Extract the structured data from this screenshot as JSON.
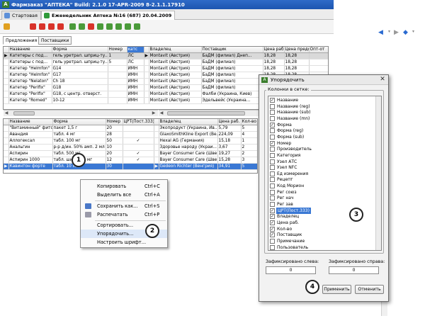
{
  "window": {
    "title": "Фармзаказ \"АПТЕКА\"   Build: 2.1.0 17-APR-2009 8-2.1.1.17910"
  },
  "tabs": [
    {
      "label": "Стартовая"
    },
    {
      "label": "Еженедельник Аптека №16 (687) 20.04.2009"
    }
  ],
  "subtabs": [
    "Предложения",
    "Поставщики"
  ],
  "top_grid": {
    "columns": [
      "Название",
      "Форма",
      "Номер",
      "катс",
      "Владелец",
      "Поставщик",
      "Цена раб.",
      "Цена предол",
      "Опт-от"
    ],
    "rows": [
      [
        "Катетеры с под...",
        "гель уретрал. шприц-ту...",
        "1",
        "ЛС",
        "Montavit (Австрия)",
        "БаДМ (филиал) Днеп...",
        "18,28",
        "18,28",
        ""
      ],
      [
        "Катетеры с под...",
        "гель уретрал. шприц-ту...",
        "5",
        "ЛС",
        "Montavit (Австрия)",
        "БаДМ (филиал)",
        "18,28",
        "18,28",
        ""
      ],
      [
        "Катетер \"Helmfon\"",
        "G14",
        "",
        "ИМН",
        "Montavit (Австрия)",
        "БаДМ (филиал)",
        "18,28",
        "18,28",
        ""
      ],
      [
        "Катетер \"Helmfon\"",
        "G17",
        "",
        "ИМН",
        "Montavit (Австрия)",
        "БаДМ (филиал)",
        "18,28",
        "18,28",
        ""
      ],
      [
        "Катетер \"Nelaton\"",
        "Ch 18",
        "",
        "ИМН",
        "Montavit (Австрия)",
        "БаДМ (филиал)",
        "18,28",
        "18,28",
        ""
      ],
      [
        "Катетер \"Perifix\"",
        "G18",
        "",
        "ИМН",
        "Montavit (Австрия)",
        "БаДМ (филиал)",
        "18,28",
        "18,28",
        ""
      ],
      [
        "Катетер \"Perifix\"",
        "G18, с центр. отверст.",
        "",
        "ИМН",
        "Montavit (Австрия)",
        "Фалби (Украина, Киев)",
        "18,28",
        "18,28",
        ""
      ],
      [
        "Катетер \"Romed\"",
        "10-12",
        "",
        "ИМН",
        "Montavit (Австрия)",
        "Эдельвейс (Украина...",
        "18,28",
        "18,28",
        ""
      ]
    ]
  },
  "bottom_grid": {
    "columns": [
      "Название",
      "Форма",
      "Номер",
      "ЦРТ(Пост.333)",
      "Владелец",
      "Цена раб.",
      "Кол-во"
    ],
    "rows": [
      [
        "\"Витаминный\" фиточай",
        "пакет 1,5 г",
        "20",
        "",
        "Экопродукт (Украина, Ив...",
        "5,79",
        "5"
      ],
      [
        "Авандия",
        "табл. 4 мг",
        "28",
        "",
        "GlaxoSmithKline Export (Ве...",
        "224,09",
        "4"
      ],
      [
        "Аллогексал",
        "табл. 100 мг",
        "50",
        "✓",
        "Hexal AG (Германия)",
        "15,18",
        "1"
      ],
      [
        "Анальгин",
        "р-р д/ин. 50% амп. 2 мл",
        "10",
        "",
        "Здоровье народу (Украи...",
        "3,67",
        "2"
      ],
      [
        "Аспирин",
        "табл. 500 мг",
        "20",
        "✓",
        "Bayer Consumer Care (Шве...",
        "19,27",
        "2"
      ],
      [
        "Аспирин 1000",
        "табл. шип. 500 мг",
        "12",
        "✓",
        "Bayer Consumer Care (Шве...",
        "15,28",
        "3"
      ],
      [
        "Кавинтон форте",
        "табл. 10 мг",
        "30",
        "",
        "Gedeon Richter (Венгрия)",
        "34,91",
        "5"
      ]
    ]
  },
  "context_menu": {
    "items": [
      {
        "label": "Копировать",
        "shortcut": "Ctrl+C"
      },
      {
        "label": "Выделить все",
        "shortcut": "Ctrl+A"
      },
      {
        "label": "Сохранить как...",
        "shortcut": "Ctrl+S"
      },
      {
        "label": "Распечатать",
        "shortcut": "Ctrl+P"
      },
      {
        "label": "Сортировать...",
        "shortcut": ""
      },
      {
        "label": "Упорядочить...",
        "shortcut": ""
      },
      {
        "label": "Настроить шрифт...",
        "shortcut": ""
      }
    ]
  },
  "dialog": {
    "title": "Упорядочить",
    "group_label": "Колонки в сетке:",
    "columns": [
      {
        "label": "Название",
        "checked": true
      },
      {
        "label": "Название (reg)",
        "checked": false
      },
      {
        "label": "Название (sub)",
        "checked": false
      },
      {
        "label": "Название (mn)",
        "checked": false
      },
      {
        "label": "Форма",
        "checked": true
      },
      {
        "label": "Форма (reg)",
        "checked": false
      },
      {
        "label": "Форма (sub)",
        "checked": false
      },
      {
        "label": "Номер",
        "checked": true
      },
      {
        "label": "Производитель",
        "checked": false
      },
      {
        "label": "Категория",
        "checked": false
      },
      {
        "label": "Узел АТС",
        "checked": false
      },
      {
        "label": "Узел NFC",
        "checked": false
      },
      {
        "label": "Ед измерения",
        "checked": false
      },
      {
        "label": "Рецепт",
        "checked": false
      },
      {
        "label": "Код Морион",
        "checked": false
      },
      {
        "label": "Рег союз",
        "checked": false
      },
      {
        "label": "Рег нач",
        "checked": false
      },
      {
        "label": "Рег зав",
        "checked": false
      },
      {
        "label": "ЦРТ(Пост.333)",
        "checked": true
      },
      {
        "label": "Владелец",
        "checked": true
      },
      {
        "label": "Цена раб.",
        "checked": true
      },
      {
        "label": "Кол-во",
        "checked": true
      },
      {
        "label": "Поставщик",
        "checked": true
      },
      {
        "label": "Примечание",
        "checked": false
      },
      {
        "label": "Пользователь",
        "checked": false
      }
    ],
    "selected_index": 18,
    "fix_left_label": "Зафиксировано слева:",
    "fix_right_label": "Зафиксировано справа:",
    "fix_left_value": "0",
    "fix_right_value": "0",
    "apply_label": "Применить",
    "cancel_label": "Отменить"
  },
  "callouts": [
    "1",
    "2",
    "3",
    "4"
  ],
  "colors": {
    "titlebar": "#1d55b0",
    "selection": "#3a78d4",
    "toolbar_red": "#d8332a",
    "toolbar_green": "#4a9a3a"
  },
  "icons": [
    "app-icon",
    "home-icon",
    "doc-icon",
    "copy-icon",
    "save-icon",
    "print-icon",
    "sort-icon",
    "checkmark-icon",
    "close-icon",
    "arrow-left-icon",
    "arrow-right-icon"
  ]
}
